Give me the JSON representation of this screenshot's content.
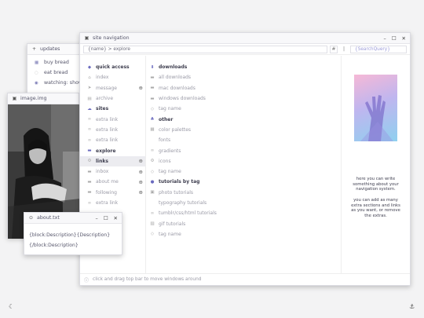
{
  "updates": {
    "title": "updates",
    "items": [
      {
        "label": "buy bread"
      },
      {
        "label": "eat bread"
      },
      {
        "label": "watching: show"
      }
    ]
  },
  "image_window": {
    "title": "image.img"
  },
  "about_window": {
    "title": "about.txt",
    "line1": "{block:Description}{Description}",
    "line2": "{/block:Description}"
  },
  "nav_window": {
    "title": "site navigation",
    "address": "{name} > explore",
    "hash": "#",
    "search_placeholder": "{SearchQuery}",
    "col1": [
      {
        "kind": "head",
        "label": "quick access",
        "icon": "pin-icon"
      },
      {
        "kind": "item",
        "label": "index",
        "icon": "home-icon"
      },
      {
        "kind": "item",
        "label": "message",
        "icon": "send-icon",
        "plus": "⊕"
      },
      {
        "kind": "item",
        "label": "archive",
        "icon": "archive-icon"
      },
      {
        "kind": "head",
        "label": "sites",
        "icon": "cloud-icon"
      },
      {
        "kind": "item",
        "label": "extra link",
        "icon": "link-icon"
      },
      {
        "kind": "item",
        "label": "extra link",
        "icon": "link-icon"
      },
      {
        "kind": "item",
        "label": "extra link",
        "icon": "link-icon"
      },
      {
        "kind": "head",
        "label": "explore",
        "icon": "folder-icon"
      },
      {
        "kind": "sel",
        "label": "links",
        "icon": "gear-icon",
        "plus": "⊕"
      },
      {
        "kind": "item",
        "label": "inbox",
        "icon": "folder-icon",
        "plus": "⊕"
      },
      {
        "kind": "item",
        "label": "about me",
        "icon": "folder-icon",
        "plus": "⊕"
      },
      {
        "kind": "item",
        "label": "following",
        "icon": "folder-icon",
        "plus": "⊕"
      },
      {
        "kind": "item",
        "label": "extra link",
        "icon": "link-icon"
      }
    ],
    "col2": [
      {
        "kind": "head",
        "label": "downloads",
        "icon": "download-icon"
      },
      {
        "kind": "item",
        "label": "all downloads",
        "icon": "folder-icon"
      },
      {
        "kind": "item",
        "label": "mac downloads",
        "icon": "folder-icon"
      },
      {
        "kind": "item",
        "label": "windows downloads",
        "icon": "folder-icon"
      },
      {
        "kind": "item",
        "label": "tag name",
        "icon": "tag-icon"
      },
      {
        "kind": "head",
        "label": "other",
        "icon": "shapes-icon"
      },
      {
        "kind": "item",
        "label": "color palettes",
        "icon": "grid-icon"
      },
      {
        "kind": "item",
        "label": "fonts",
        "icon": "none"
      },
      {
        "kind": "item",
        "label": "gradients",
        "icon": "link-icon"
      },
      {
        "kind": "item",
        "label": "icons",
        "icon": "gear-icon"
      },
      {
        "kind": "item",
        "label": "tag name",
        "icon": "tag-icon"
      },
      {
        "kind": "head",
        "label": "tutorials by tag",
        "icon": "circle-icon"
      },
      {
        "kind": "item",
        "label": "photo tutorials",
        "icon": "image-icon"
      },
      {
        "kind": "item",
        "label": "typography tutorials",
        "icon": "none"
      },
      {
        "kind": "item",
        "label": "tumblr/css/html tutorials",
        "icon": "link-icon"
      },
      {
        "kind": "item",
        "label": "gif tutorials",
        "icon": "gif-icon"
      },
      {
        "kind": "item",
        "label": "tag name",
        "icon": "tag-icon"
      }
    ],
    "description": "here you can write something about your navigation system.\n\nyou can add as many extra sections and links as you want, or remove the extras.",
    "status": "click and drag top bar to move windows around"
  }
}
